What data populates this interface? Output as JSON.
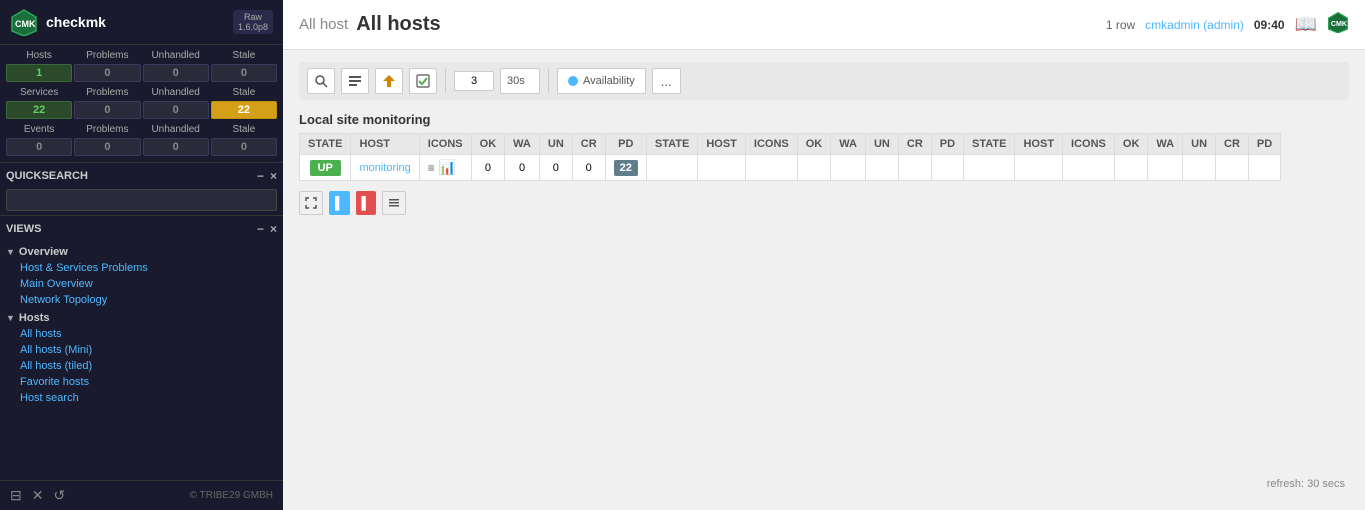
{
  "app": {
    "title": "checkmk",
    "version": "Raw\n1.6.0p8"
  },
  "sidebar": {
    "stats": {
      "hosts_label": "Hosts",
      "problems_label": "Problems",
      "unhandled_label": "Unhandled",
      "stale_label": "Stale",
      "hosts_value": "1",
      "hosts_problems": "0",
      "hosts_unhandled": "0",
      "hosts_stale": "0",
      "services_label": "Services",
      "services_value": "22",
      "services_problems": "0",
      "services_unhandled": "0",
      "services_stale": "22",
      "events_label": "Events",
      "events_value": "0",
      "events_problems": "0",
      "events_unhandled": "0",
      "events_stale": "0"
    },
    "quicksearch": {
      "label": "QUICKSEARCH",
      "placeholder": ""
    },
    "views": {
      "label": "VIEWS",
      "overview_label": "Overview",
      "items": [
        {
          "label": "Host & Services Problems",
          "indent": true
        },
        {
          "label": "Main Overview",
          "indent": true
        },
        {
          "label": "Network Topology",
          "indent": true
        }
      ],
      "hosts_label": "Hosts",
      "hosts_items": [
        {
          "label": "All hosts"
        },
        {
          "label": "All hosts (Mini)"
        },
        {
          "label": "All hosts (tiled)"
        },
        {
          "label": "Favorite hosts"
        },
        {
          "label": "Host search"
        }
      ]
    },
    "footer": {
      "copyright": "© TRIBE29 GMBH"
    }
  },
  "topbar": {
    "breadcrumb_part": "All host",
    "title": "All hosts",
    "row_count": "1 row",
    "user": "cmkadmin (admin)",
    "time": "09:40"
  },
  "toolbar": {
    "number_value": "3",
    "interval_value": "30s",
    "availability_label": "Availability",
    "dots_label": "..."
  },
  "content": {
    "site_title": "Local site monitoring",
    "table_headers": [
      "STATE",
      "HOST",
      "ICONS",
      "OK",
      "WA",
      "UN",
      "CR",
      "PD"
    ],
    "table_headers_2": [
      "STATE",
      "HOST",
      "ICONS",
      "OK",
      "WA",
      "UN",
      "CR",
      "PD"
    ],
    "table_headers_3": [
      "STATE",
      "HOST",
      "ICONS",
      "OK",
      "WA",
      "UN",
      "CR",
      "PD"
    ],
    "row": {
      "state": "UP",
      "host": "monitoring",
      "ok": "0",
      "wa": "0",
      "un": "0",
      "cr": "0",
      "pd": "22"
    },
    "refresh_text": "refresh: 30 secs"
  }
}
